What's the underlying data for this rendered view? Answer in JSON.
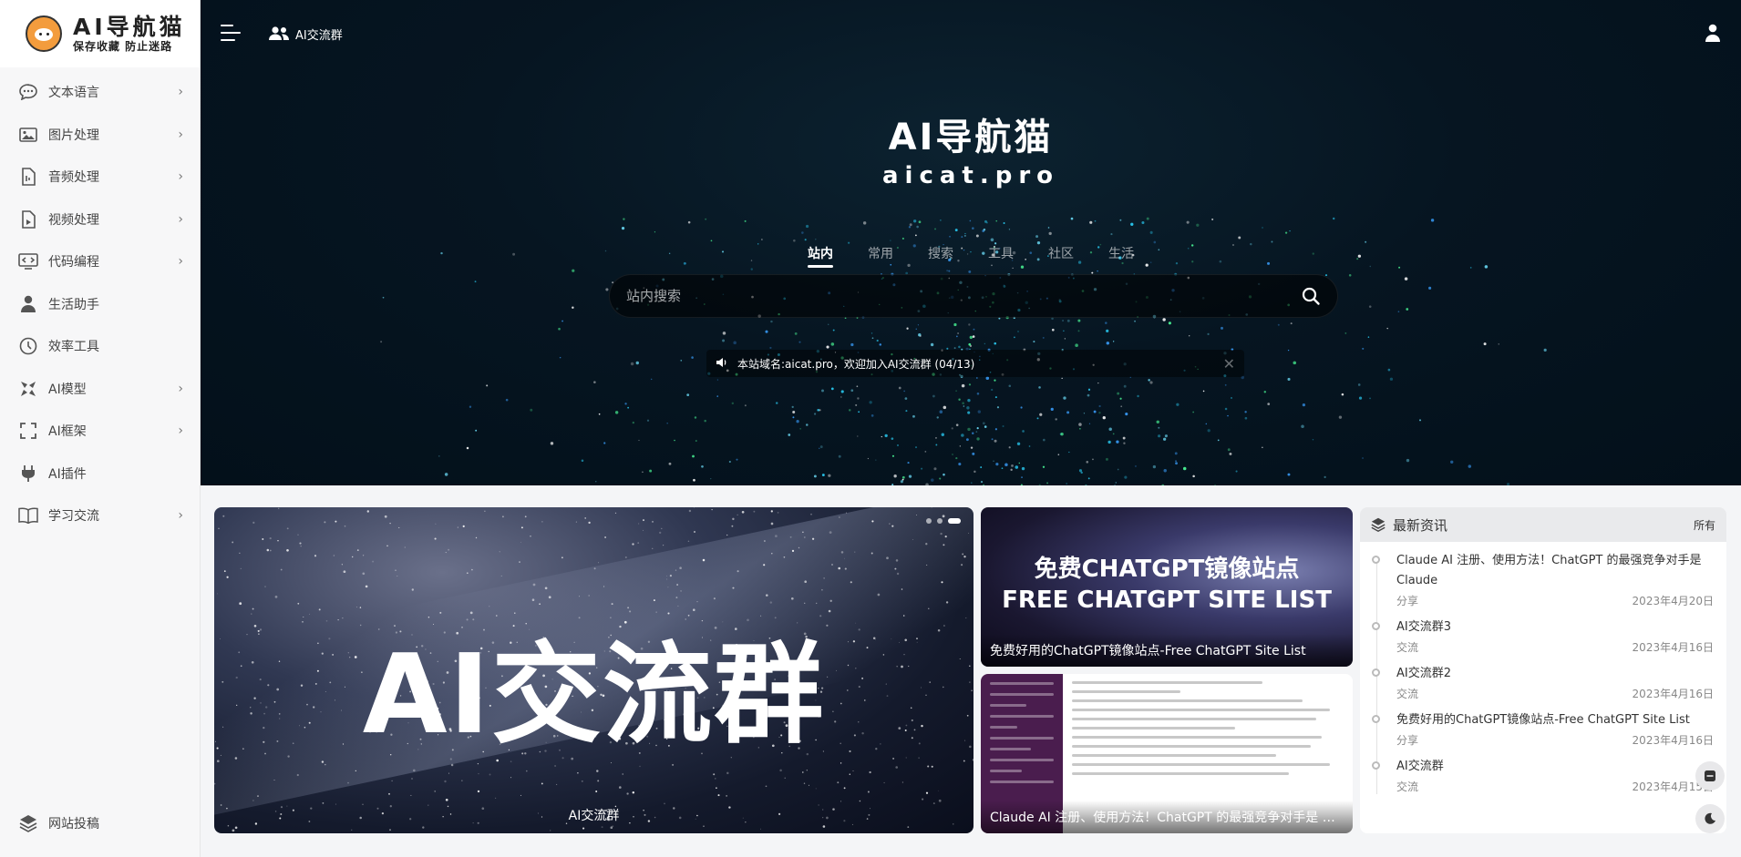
{
  "brand": {
    "title": "AI导航猫",
    "subtitle": "保存收藏   防止迷路"
  },
  "sidebar": {
    "items": [
      {
        "label": "文本语言",
        "icon": "chat-bubble-icon",
        "has_submenu": true
      },
      {
        "label": "图片处理",
        "icon": "image-icon",
        "has_submenu": true
      },
      {
        "label": "音频处理",
        "icon": "audio-file-icon",
        "has_submenu": true
      },
      {
        "label": "视频处理",
        "icon": "video-file-icon",
        "has_submenu": true
      },
      {
        "label": "代码编程",
        "icon": "code-monitor-icon",
        "has_submenu": true
      },
      {
        "label": "生活助手",
        "icon": "person-icon",
        "has_submenu": false
      },
      {
        "label": "效率工具",
        "icon": "clock-icon",
        "has_submenu": false
      },
      {
        "label": "AI模型",
        "icon": "model-icon",
        "has_submenu": true
      },
      {
        "label": "AI框架",
        "icon": "frame-icon",
        "has_submenu": true
      },
      {
        "label": "AI插件",
        "icon": "plug-icon",
        "has_submenu": false
      },
      {
        "label": "学习交流",
        "icon": "book-icon",
        "has_submenu": true
      }
    ],
    "bottom": {
      "label": "网站投稿",
      "icon": "layers-icon"
    }
  },
  "topbar": {
    "group_link": "AI交流群"
  },
  "hero": {
    "title": "AI导航猫",
    "subtitle": "aicat.pro",
    "tabs": [
      "站内",
      "常用",
      "搜索",
      "工具",
      "社区",
      "生活"
    ],
    "active_tab": 0,
    "search_placeholder": "站内搜索",
    "notice": "本站域名:aicat.pro，欢迎加入AI交流群 (04/13)"
  },
  "slider": {
    "art_text": "AI交流群",
    "caption": "AI交流群"
  },
  "cards": [
    {
      "art_line1": "免费CHATGPT镜像站点",
      "art_line2": "FREE CHATGPT SITE LIST",
      "title": "免费好用的ChatGPT镜像站点-Free ChatGPT Site List"
    },
    {
      "title": "Claude AI 注册、使用方法！ChatGPT 的最强竞争对手是 Claude"
    }
  ],
  "news": {
    "heading": "最新资讯",
    "all_label": "所有",
    "items": [
      {
        "title": "Claude AI 注册、使用方法！ChatGPT 的最强竞争对手是 Claude",
        "category": "分享",
        "date": "2023年4月20日"
      },
      {
        "title": "AI交流群3",
        "category": "交流",
        "date": "2023年4月16日"
      },
      {
        "title": "AI交流群2",
        "category": "交流",
        "date": "2023年4月16日"
      },
      {
        "title": "免费好用的ChatGPT镜像站点-Free ChatGPT Site List",
        "category": "分享",
        "date": "2023年4月16日"
      },
      {
        "title": "AI交流群",
        "category": "交流",
        "date": "2023年4月15日"
      }
    ]
  }
}
